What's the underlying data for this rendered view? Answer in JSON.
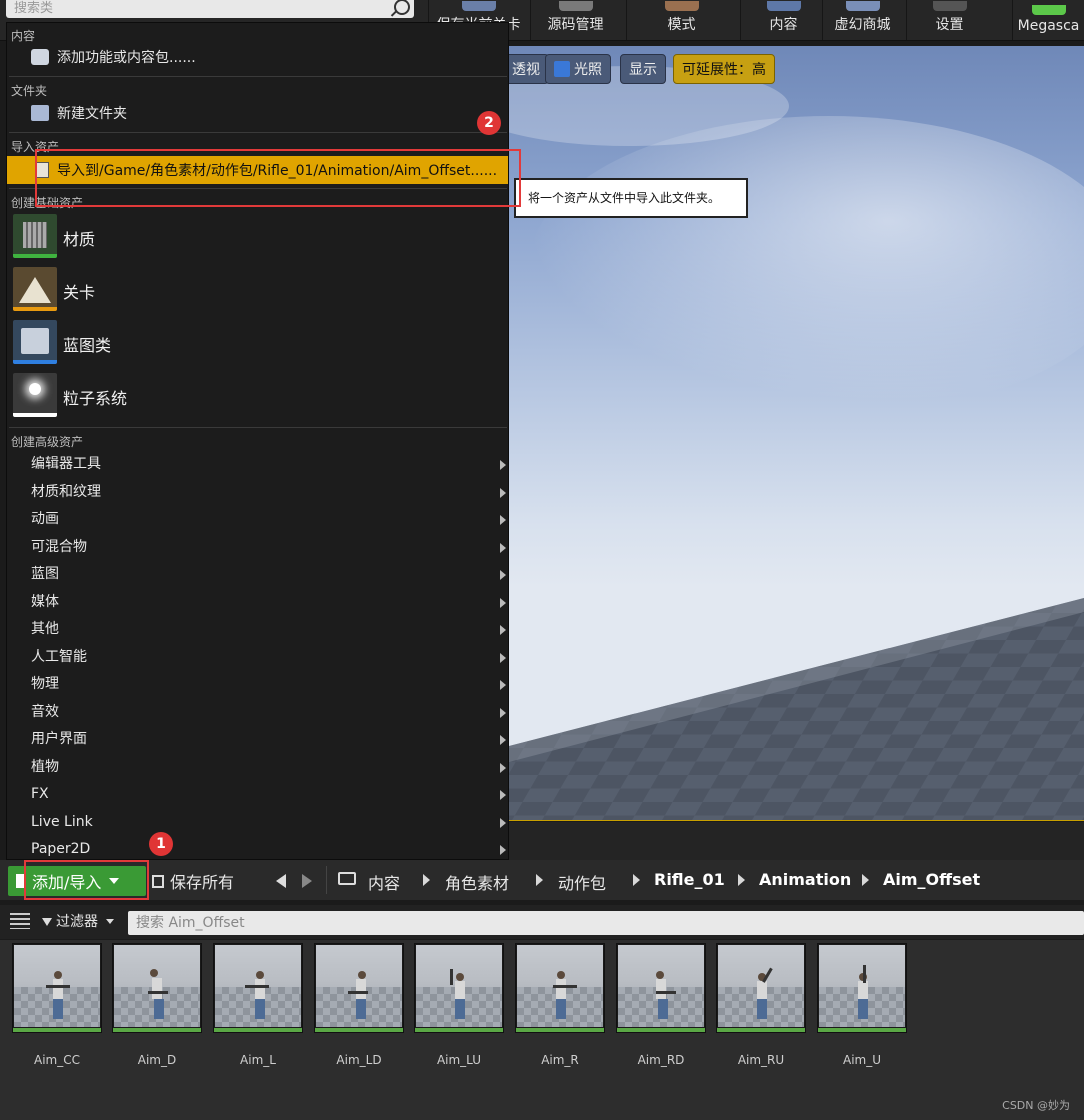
{
  "toolbar": {
    "search_placeholder": "搜索类",
    "buttons": [
      "保存当前关卡",
      "源码管理",
      "模式",
      "内容",
      "虚幻商城",
      "设置",
      "Megasca"
    ]
  },
  "viewport": {
    "chips": [
      "透视",
      "光照",
      "显示",
      "可延展性：高"
    ]
  },
  "menu": {
    "content_header": "内容",
    "add_feature": "添加功能或内容包......",
    "folder_header": "文件夹",
    "new_folder": "新建文件夹",
    "import_header": "导入资产",
    "import_item": "导入到/Game/角色素材/动作包/Rifle_01/Animation/Aim_Offset......",
    "basic_header": "创建基础资产",
    "basic_assets": [
      {
        "label": "材质",
        "color": "#3fb43f"
      },
      {
        "label": "关卡",
        "color": "#e89a10"
      },
      {
        "label": "蓝图类",
        "color": "#2f7fe0"
      },
      {
        "label": "粒子系统",
        "color": "#ffffff"
      }
    ],
    "advanced_header": "创建高级资产",
    "advanced_items": [
      "编辑器工具",
      "材质和纹理",
      "动画",
      "可混合物",
      "蓝图",
      "媒体",
      "其他",
      "人工智能",
      "物理",
      "音效",
      "用户界面",
      "植物",
      "FX",
      "Live Link",
      "Paper2D"
    ]
  },
  "tooltip": "将一个资产从文件中导入此文件夹。",
  "badges": [
    "1",
    "2"
  ],
  "content_browser": {
    "add_import": "添加/导入",
    "save_all": "保存所有",
    "breadcrumbs": [
      "内容",
      "角色素材",
      "动作包",
      "Rifle_01",
      "Animation",
      "Aim_Offset"
    ],
    "filters": "过滤器",
    "search_placeholder": "搜索 Aim_Offset",
    "assets": [
      "Aim_CC",
      "Aim_D",
      "Aim_L",
      "Aim_LD",
      "Aim_LU",
      "Aim_R",
      "Aim_RD",
      "Aim_RU",
      "Aim_U"
    ]
  },
  "watermark": "CSDN @妙为"
}
